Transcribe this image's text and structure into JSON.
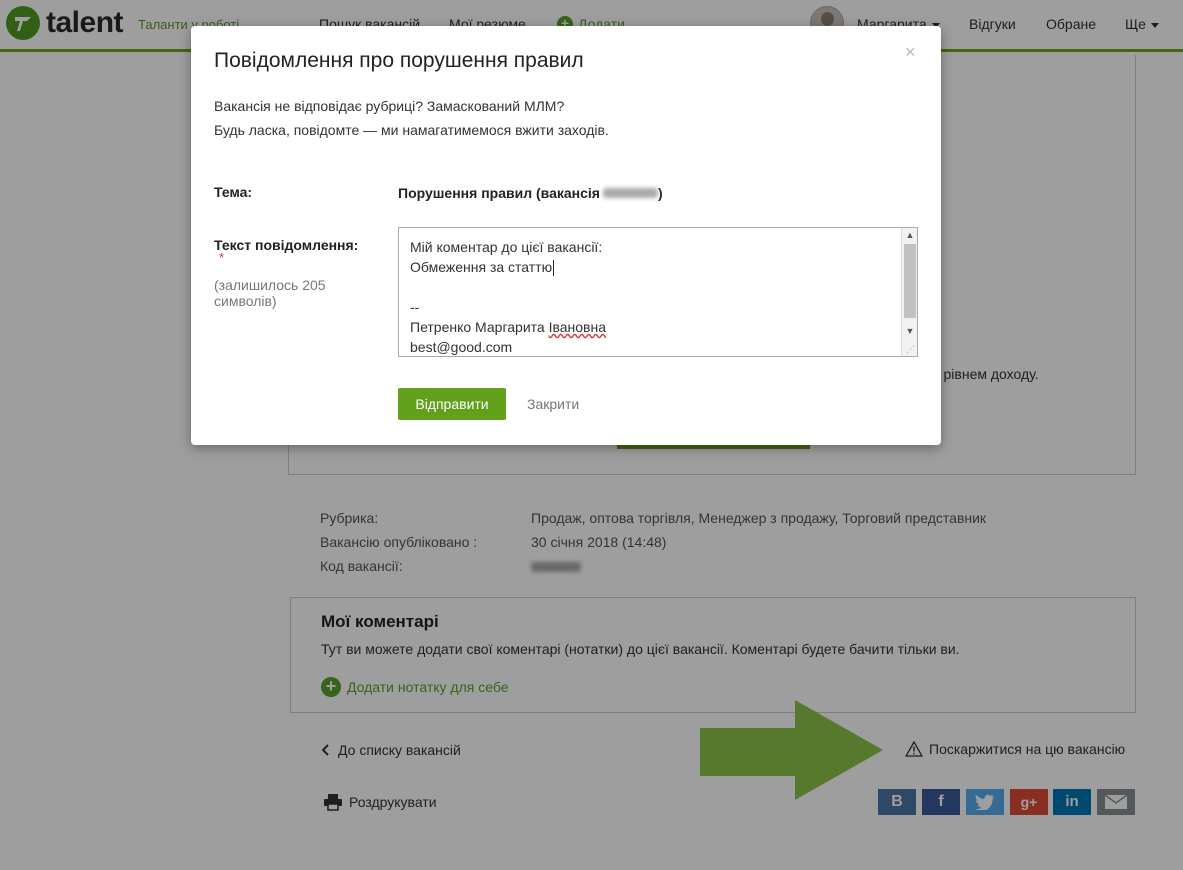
{
  "header": {
    "logo_text": "talent",
    "tagline": "Таланти у роботі",
    "nav": {
      "search": "Пошук вакансій",
      "resumes": "Мої резюме",
      "add": "Додати"
    },
    "user_name": "Маргарита",
    "responses": "Відгуки",
    "favorites": "Обране",
    "more": "Ще"
  },
  "page": {
    "behind_text": "м рівнем доходу.",
    "meta": {
      "category_label": "Рубрика:",
      "category_value": "Продаж, оптова торгівля,  Менеджер з продажу,  Торговий представник",
      "published_label": "Вакансію опубліковано :",
      "published_value": "30 січня 2018 (14:48)",
      "code_label": "Код вакансії:"
    },
    "comments": {
      "title": "Мої коментарі",
      "description": "Тут ви можете додати свої коментарі (нотатки) до цієї вакансії. Коментарі будете бачити тільки ви.",
      "add_note": "Додати нотатку для себе"
    },
    "back_link": "До списку вакансій",
    "complain_link": "Поскаржитися на цю вакансію",
    "print_link": "Роздрукувати",
    "share": {
      "vk": "B",
      "fb": "f",
      "gplus": "g+",
      "linkedin": "in"
    },
    "colors": {
      "vk": "#4c75a3",
      "fb": "#3b5998",
      "twitter": "#55acee",
      "gplus": "#dd4b39",
      "linkedin": "#0077b5",
      "email": "#8a8f94",
      "accent": "#62a01c",
      "arrow": "#8bc34a"
    }
  },
  "modal": {
    "title": "Повідомлення про порушення правил",
    "intro_line1": "Вакансія не відповідає рубриці? Замаскований МЛМ?",
    "intro_line2": "Будь ласка, повідомте — ми намагатимемося вжити заходів.",
    "subject_label": "Тема:",
    "subject_value": "Порушення правил (вакансія",
    "subject_close": ")",
    "message_label": "Текст повідомлення:",
    "required_mark": "*",
    "chars_left": "(залишилось 205 символів)",
    "message_lines": [
      "Мій коментар до цієї вакансії:",
      "Обмеження за статтю",
      "",
      "--",
      "Петренко Маргарита ",
      "best@good.com"
    ],
    "patronymic": "Івановна",
    "send_button": "Відправити",
    "close_button": "Закрити",
    "close_icon": "×"
  }
}
